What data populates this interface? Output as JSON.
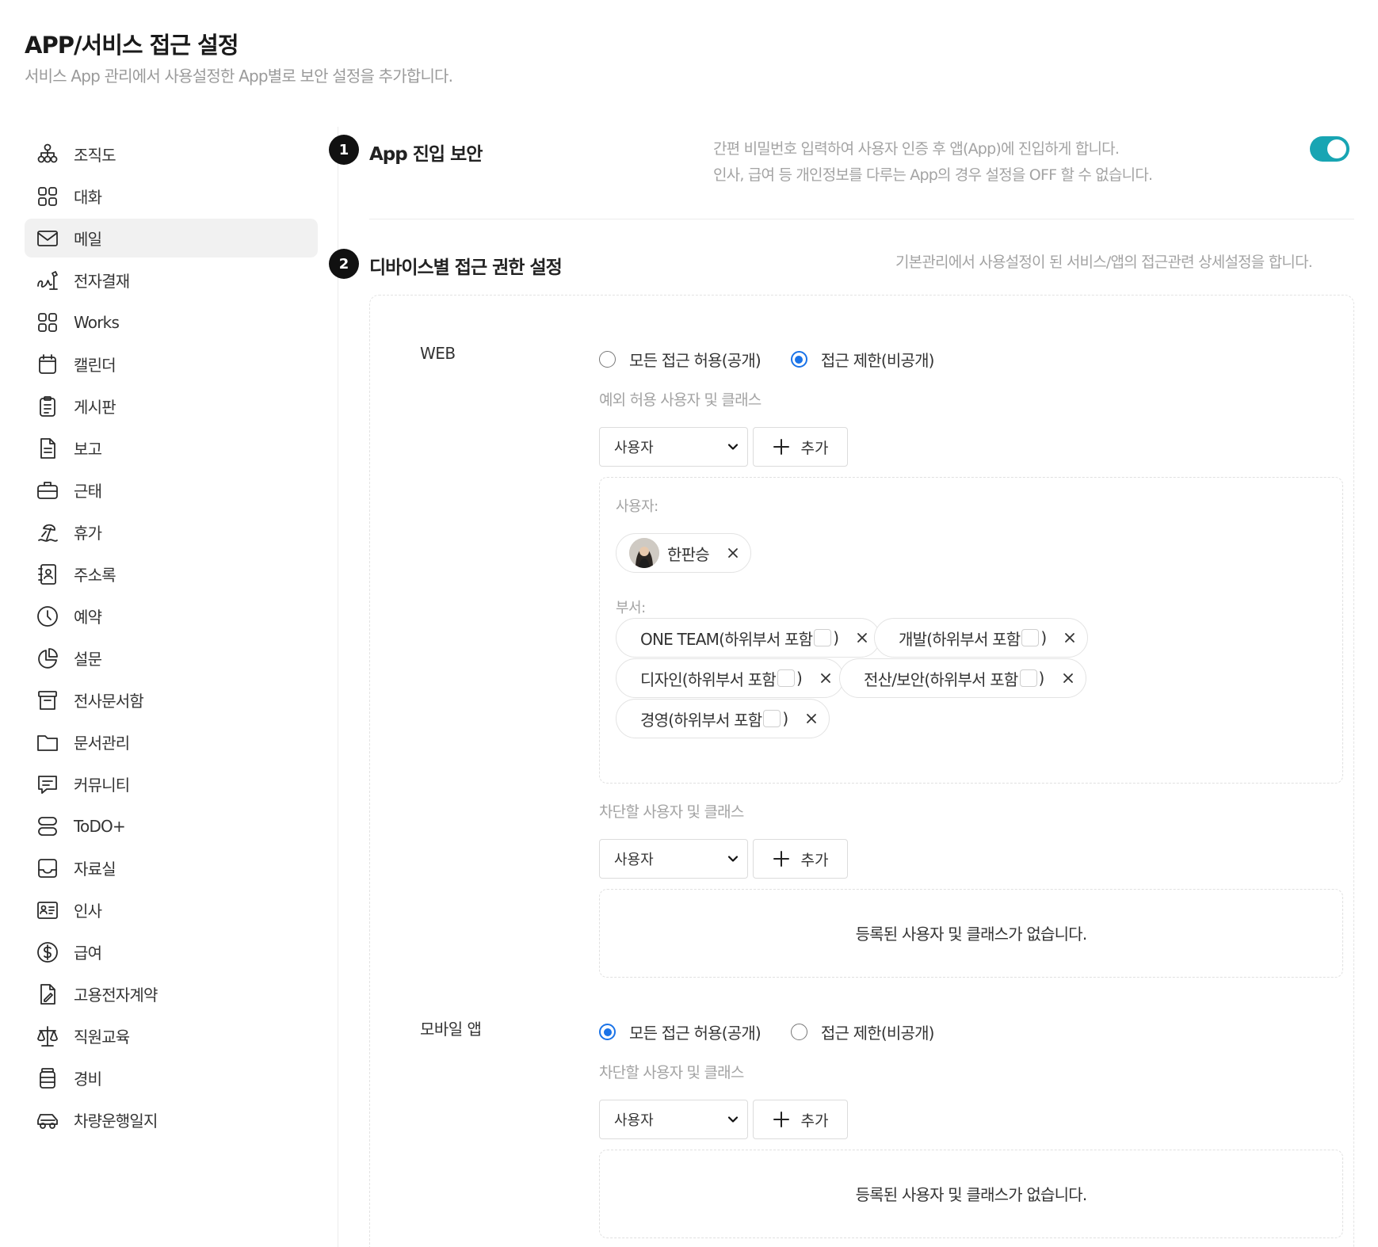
{
  "header": {
    "title": "APP/서비스 접근 설정",
    "subtitle": "서비스 App 관리에서 사용설정한 App별로 보안 설정을 추가합니다."
  },
  "sidebar": {
    "items": [
      {
        "label": "조직도",
        "icon": "org-chart-icon"
      },
      {
        "label": "대화",
        "icon": "grid-icon"
      },
      {
        "label": "메일",
        "icon": "mail-icon",
        "active": true
      },
      {
        "label": "전자결재",
        "icon": "signature-icon"
      },
      {
        "label": "Works",
        "icon": "grid-icon"
      },
      {
        "label": "캘린더",
        "icon": "calendar-icon"
      },
      {
        "label": "게시판",
        "icon": "clipboard-icon"
      },
      {
        "label": "보고",
        "icon": "document-icon"
      },
      {
        "label": "근태",
        "icon": "briefcase-icon"
      },
      {
        "label": "휴가",
        "icon": "beach-icon"
      },
      {
        "label": "주소록",
        "icon": "address-book-icon"
      },
      {
        "label": "예약",
        "icon": "clock-icon"
      },
      {
        "label": "설문",
        "icon": "pie-chart-icon"
      },
      {
        "label": "전사문서함",
        "icon": "archive-icon"
      },
      {
        "label": "문서관리",
        "icon": "folder-icon"
      },
      {
        "label": "커뮤니티",
        "icon": "chat-icon"
      },
      {
        "label": "ToDO+",
        "icon": "stack-icon"
      },
      {
        "label": "자료실",
        "icon": "inbox-icon"
      },
      {
        "label": "인사",
        "icon": "id-card-icon"
      },
      {
        "label": "급여",
        "icon": "dollar-icon"
      },
      {
        "label": "고용전자계약",
        "icon": "contract-icon"
      },
      {
        "label": "직원교육",
        "icon": "scale-icon"
      },
      {
        "label": "경비",
        "icon": "receipt-icon"
      },
      {
        "label": "차량운행일지",
        "icon": "car-icon"
      }
    ]
  },
  "section1": {
    "number": "1",
    "title": "App 진입 보안",
    "desc_line1": "간편 비밀번호 입력하여 사용자 인증 후 앱(App)에 진입하게 합니다.",
    "desc_line2": "인사, 급여 등 개인정보를 다루는 App의 경우 설정을 OFF 할 수 없습니다.",
    "toggle_on": true,
    "accent_color": "#18a5b3"
  },
  "section2": {
    "number": "2",
    "title": "디바이스별 접근 권한 설정",
    "desc": "기본관리에서 사용설정이 된 서비스/앱의 접근관련 상세설정을 합니다."
  },
  "web": {
    "label": "WEB",
    "option_all": "모든 접근 허용(공개)",
    "option_restrict": "접근 제한(비공개)",
    "selected": "restrict",
    "exception_label": "예외 허용 사용자 및 클래스",
    "select_value": "사용자",
    "add_label": "추가",
    "users_label": "사용자:",
    "users": [
      {
        "name": "한판승"
      }
    ],
    "depts_label": "부서:",
    "departments": [
      {
        "before": "ONE TEAM(하위부서 포함",
        "after": ")"
      },
      {
        "before": "개발(하위부서 포함",
        "after": ")"
      },
      {
        "before": "디자인(하위부서 포함",
        "after": ")"
      },
      {
        "before": "전산/보안(하위부서 포함",
        "after": ")"
      },
      {
        "before": "경영(하위부서 포함",
        "after": ")"
      }
    ],
    "block_label": "차단할 사용자 및 클래스",
    "block_select_value": "사용자",
    "block_add_label": "추가",
    "block_empty": "등록된 사용자 및 클래스가 없습니다."
  },
  "mobile": {
    "label": "모바일 앱",
    "option_all": "모든 접근 허용(공개)",
    "option_restrict": "접근 제한(비공개)",
    "selected": "all",
    "block_label": "차단할 사용자 및 클래스",
    "select_value": "사용자",
    "add_label": "추가",
    "empty": "등록된 사용자 및 클래스가 없습니다."
  },
  "colors": {
    "radio_selected": "#1a73e8",
    "badge": "#111111"
  }
}
